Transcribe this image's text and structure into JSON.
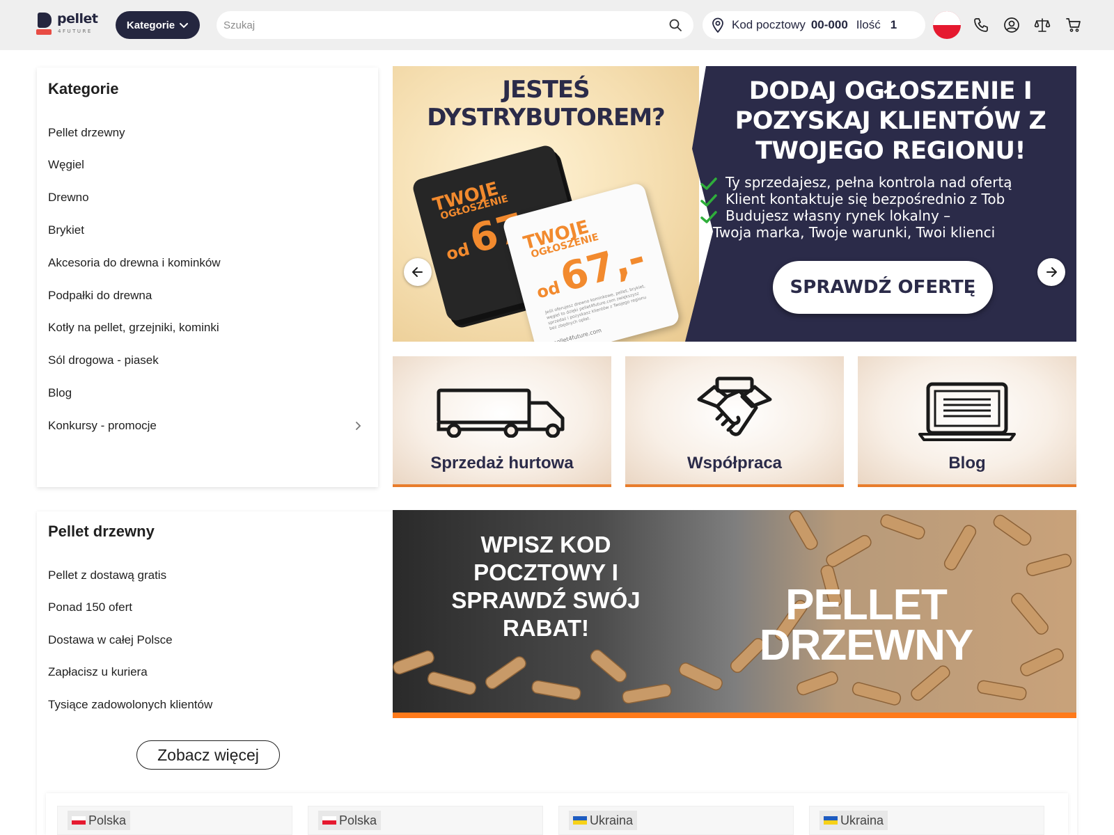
{
  "header": {
    "logo_text": "pellet",
    "logo_sub": "4FUTURE",
    "categories_button": "Kategorie",
    "search_placeholder": "Szukaj",
    "postal_label": "Kod pocztowy",
    "postal_code": "00-000",
    "quantity_label": "Ilość",
    "quantity_value": "1",
    "language": "pl"
  },
  "categories_card": {
    "title": "Kategorie",
    "items": [
      {
        "label": "Pellet drzewny"
      },
      {
        "label": "Węgiel"
      },
      {
        "label": "Drewno"
      },
      {
        "label": "Brykiet"
      },
      {
        "label": "Akcesoria do drewna i kominków"
      },
      {
        "label": "Podpałki do drewna"
      },
      {
        "label": "Kotły na pellet, grzejniki, kominki"
      },
      {
        "label": "Sól drogowa - piasek"
      },
      {
        "label": "Blog"
      },
      {
        "label": "Konkursy - promocje",
        "has_submenu": true
      }
    ]
  },
  "hero": {
    "question": "JESTEŚ DYSTRYBUTOREM?",
    "headline": "DODAJ OGŁOSZENIE I POZYSKAJ KLIENTÓW Z TWOJEGO REGIONU!",
    "bullets": [
      "Ty sprzedajesz, pełna kontrola nad ofertą",
      "Klient kontaktuje się bezpośrednio z Tob",
      "Budujesz własny rynek lokalny –"
    ],
    "bullet_tail": "Twoja marka, Twoje warunki, Twoi klienci",
    "cta": "SPRAWDŹ OFERTĘ",
    "card_title_1": "TWOJE",
    "card_title_2": "OGŁOSZENIE",
    "card_od": "od",
    "card_price": "67,-",
    "card_fine": "Jeśli oferujesz drewno kominkowe, pellet, brykiet, węgiel to dzięki pellet4future.com zwiększysz sprzedaż i pozyskasz klientów z Twojego regionu bez zbędnych opłat.",
    "card_url": "pellet4future.com"
  },
  "tiles": [
    {
      "label": "Sprzedaż hurtowa",
      "icon": "truck-icon"
    },
    {
      "label": "Współpraca",
      "icon": "handshake-icon"
    },
    {
      "label": "Blog",
      "icon": "laptop-icon"
    }
  ],
  "pellet_card": {
    "title": "Pellet drzewny",
    "items": [
      "Pellet z dostawą gratis",
      "Ponad 150 ofert",
      "Dostawa w całej Polsce",
      "Zapłacisz u kuriera",
      "Tysiące zadowolonych klientów"
    ],
    "more_button": "Zobacz więcej"
  },
  "pellet_banner": {
    "message": "WPISZ KOD POCZTOWY I SPRAWDŹ SWÓJ RABAT!",
    "big_line1": "PELLET",
    "big_line2": "DRZEWNY"
  },
  "products": [
    {
      "country": "Polska",
      "flag": "pl"
    },
    {
      "country": "Polska",
      "flag": "pl"
    },
    {
      "country": "Ukraina",
      "flag": "ua"
    },
    {
      "country": "Ukraina",
      "flag": "ua"
    }
  ],
  "colors": {
    "navy": "#24263f",
    "accent_orange": "#e87d2c",
    "brand_red": "#e84c44",
    "header_bg": "#efefef"
  }
}
